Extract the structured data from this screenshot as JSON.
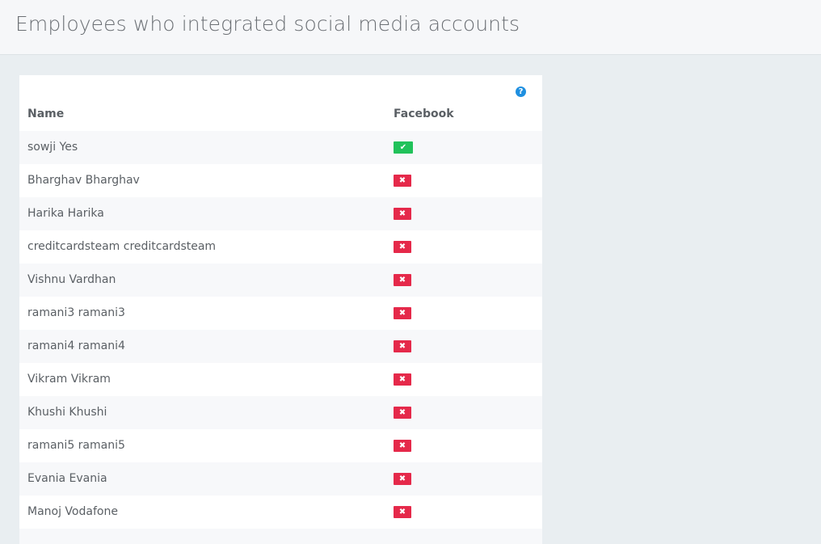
{
  "header": {
    "title": "Employees who integrated social media accounts"
  },
  "table": {
    "help_icon": "question-circle-icon",
    "columns": [
      "Name",
      "Facebook"
    ],
    "rows": [
      {
        "name": "sowji Yes",
        "facebook": true
      },
      {
        "name": "Bharghav Bharghav",
        "facebook": false
      },
      {
        "name": "Harika Harika",
        "facebook": false
      },
      {
        "name": "creditcardsteam creditcardsteam",
        "facebook": false
      },
      {
        "name": "Vishnu Vardhan",
        "facebook": false
      },
      {
        "name": "ramani3 ramani3",
        "facebook": false
      },
      {
        "name": "ramani4 ramani4",
        "facebook": false
      },
      {
        "name": "Vikram Vikram",
        "facebook": false
      },
      {
        "name": "Khushi Khushi",
        "facebook": false
      },
      {
        "name": "ramani5 ramani5",
        "facebook": false
      },
      {
        "name": "Evania Evania",
        "facebook": false
      },
      {
        "name": "Manoj Vodafone",
        "facebook": false
      },
      {
        "name": "",
        "facebook": null
      }
    ]
  },
  "colors": {
    "yes_badge": "#21c25a",
    "no_badge": "#e5294a",
    "help_icon": "#1e8fe0"
  }
}
